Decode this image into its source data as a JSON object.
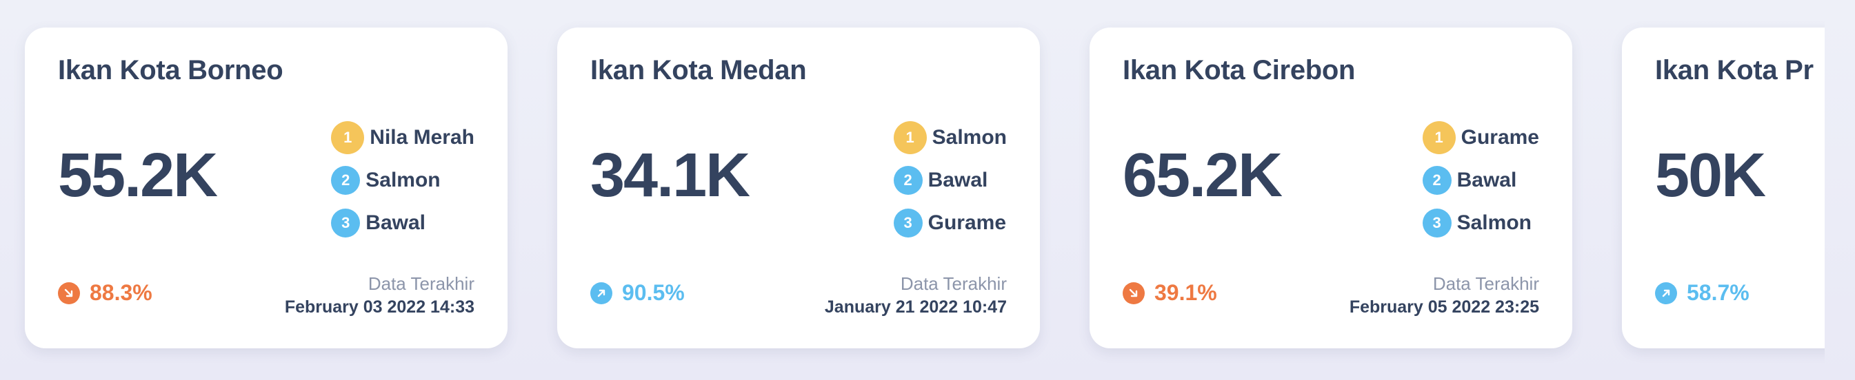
{
  "colors": {
    "rank_gold": "#f5c55a",
    "rank_blue": "#5bbdf0",
    "trend_down": "#ee7942",
    "trend_up": "#5bbdf0",
    "text_dark": "#34435f",
    "text_muted": "#8c95aa"
  },
  "cards": [
    {
      "title": "Ikan Kota Borneo",
      "value": "55.2K",
      "ranks": [
        {
          "num": "1",
          "name": "Nila Merah"
        },
        {
          "num": "2",
          "name": "Salmon"
        },
        {
          "num": "3",
          "name": "Bawal"
        }
      ],
      "trend": {
        "direction": "down",
        "icon": "arrow-down-right-icon",
        "percent": "88.3%"
      },
      "last_label": "Data Terakhir",
      "last_date": "February 03 2022 14:33"
    },
    {
      "title": "Ikan Kota Medan",
      "value": "34.1K",
      "ranks": [
        {
          "num": "1",
          "name": "Salmon"
        },
        {
          "num": "2",
          "name": "Bawal"
        },
        {
          "num": "3",
          "name": "Gurame"
        }
      ],
      "trend": {
        "direction": "up",
        "icon": "arrow-up-right-icon",
        "percent": "90.5%"
      },
      "last_label": "Data Terakhir",
      "last_date": "January 21 2022 10:47"
    },
    {
      "title": "Ikan Kota Cirebon",
      "value": "65.2K",
      "ranks": [
        {
          "num": "1",
          "name": "Gurame"
        },
        {
          "num": "2",
          "name": "Bawal"
        },
        {
          "num": "3",
          "name": "Salmon"
        }
      ],
      "trend": {
        "direction": "down",
        "icon": "arrow-down-right-icon",
        "percent": "39.1%"
      },
      "last_label": "Data Terakhir",
      "last_date": "February 05 2022 23:25"
    },
    {
      "title": "Ikan Kota Pr",
      "value": "50K",
      "ranks": [],
      "trend": {
        "direction": "up",
        "icon": "arrow-up-right-icon",
        "percent": "58.7%"
      },
      "last_label": "",
      "last_date": ""
    }
  ]
}
